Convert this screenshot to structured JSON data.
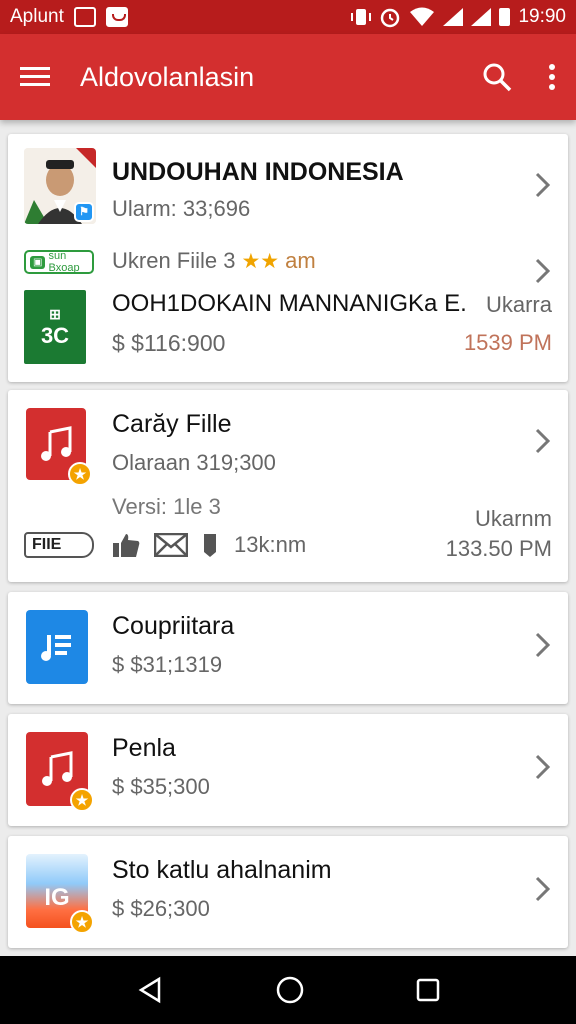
{
  "status_bar": {
    "carrier": "Aplunt",
    "time": "19:90"
  },
  "app_bar": {
    "title": "Aldovolanlasin"
  },
  "cards": [
    {
      "title": "UNDOUHAN INDONESIA",
      "subtitle": "Ularm: 33;696",
      "line2": "Ukren Fiile 3",
      "line2_suffix": "am",
      "badge_text": "sun Bxoap",
      "item_title": "OOH1DOKAIN MANNANIGKa E.",
      "item_price": "$ $116:900",
      "right_label": "Ukarra",
      "right_time": "1539 PM",
      "thumb_text": "3C"
    },
    {
      "title": "Carăy Fille",
      "subtitle": "Olaraan 319;300",
      "version": "Versi: 1le 3",
      "file_tag": "FIIE",
      "count": "13k:nm",
      "right_label": "Ukarnm",
      "right_time": "133.50 PM"
    },
    {
      "title": "Coupriitara",
      "price": "$ $31;1319"
    },
    {
      "title": "Penla",
      "price": "$ $35;300"
    },
    {
      "title": "Sto katlu ahalnanim",
      "price": "$ $26;300",
      "thumb_text": "IG"
    }
  ],
  "colors": {
    "primary": "#d32f2f",
    "status": "#b71c1c",
    "accent": "#f4a300",
    "price_time": "#c0735a"
  }
}
